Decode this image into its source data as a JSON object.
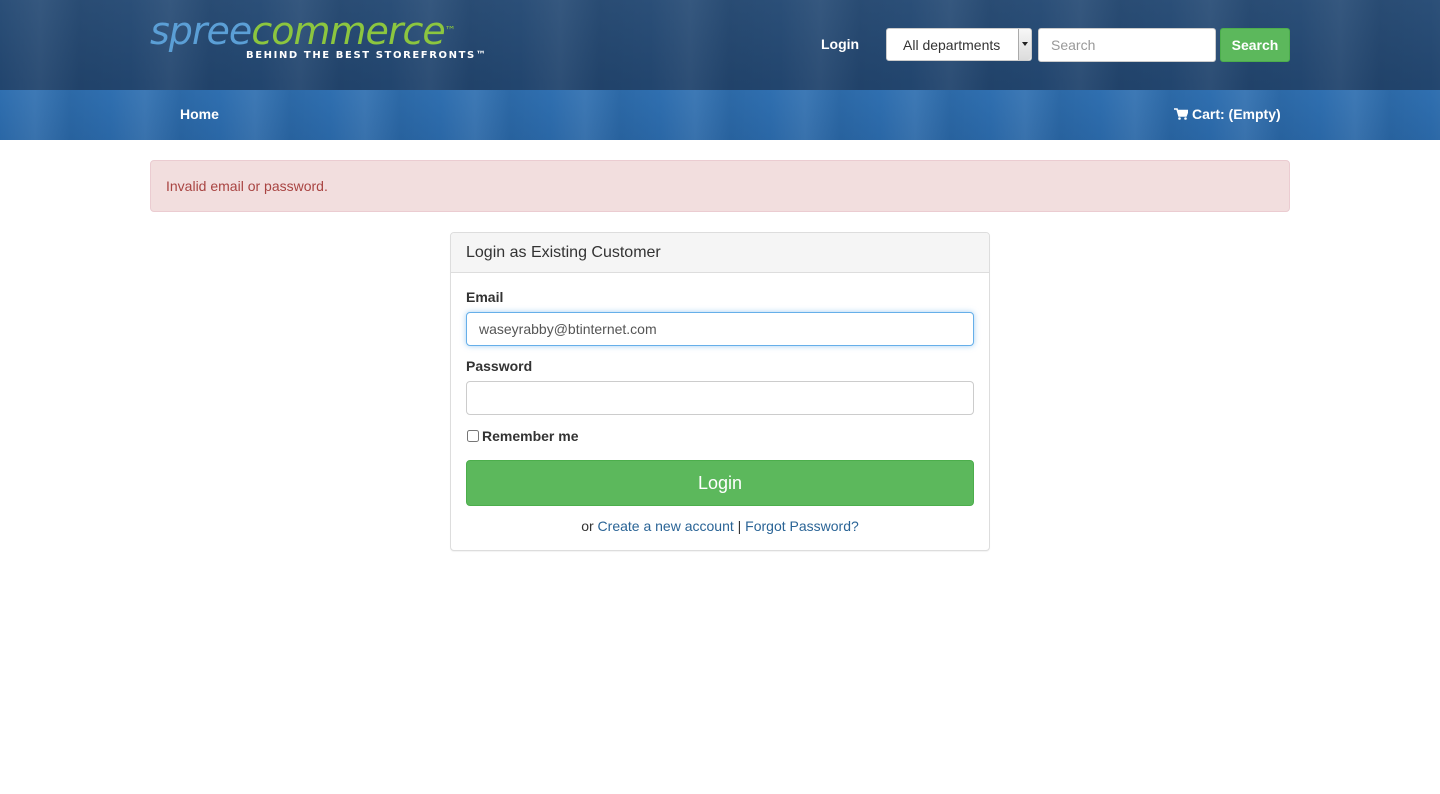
{
  "header": {
    "logo": {
      "brand_part1": "spree",
      "brand_part2": "commerce",
      "trademark": "™",
      "tagline": "BEHIND THE BEST STOREFRONTS™"
    },
    "login_label": "Login",
    "departments": {
      "selected": "All departments"
    },
    "search": {
      "placeholder": "Search",
      "button_label": "Search"
    }
  },
  "nav": {
    "home_label": "Home",
    "cart_label": "Cart: (Empty)",
    "cart_icon": "shopping-cart-icon"
  },
  "alert": {
    "message": "Invalid email or password."
  },
  "login_panel": {
    "title": "Login as Existing Customer",
    "email_label": "Email",
    "email_value": "waseyrabby@btinternet.com",
    "password_label": "Password",
    "password_value": "",
    "remember_label": "Remember me",
    "remember_checked": false,
    "submit_label": "Login",
    "or_text": "or",
    "create_account_label": "Create a new account",
    "separator": "|",
    "forgot_password_label": "Forgot Password?"
  },
  "colors": {
    "header_blue": "#22456e",
    "nav_blue": "#2a67a6",
    "success_green": "#5cb85c",
    "alert_bg": "#f2dede",
    "alert_text": "#a94442",
    "link_blue": "#2a6496"
  }
}
